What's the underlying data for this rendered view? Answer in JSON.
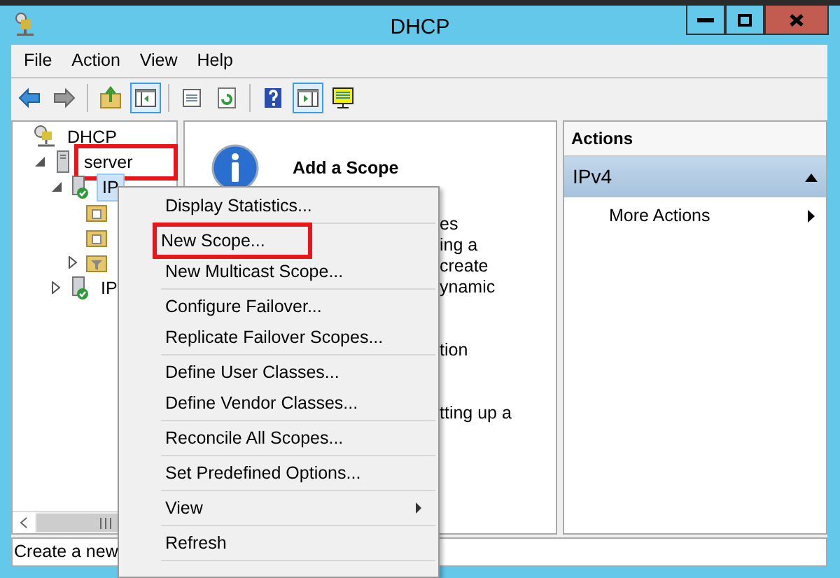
{
  "window": {
    "title": "DHCP"
  },
  "menu_bar": [
    "File",
    "Action",
    "View",
    "Help"
  ],
  "toolbar": [
    {
      "kind": "back",
      "pressed": false
    },
    {
      "kind": "forward",
      "pressed": false
    },
    {
      "kind": "sep"
    },
    {
      "kind": "up",
      "pressed": false
    },
    {
      "kind": "tree",
      "pressed": true
    },
    {
      "kind": "sep"
    },
    {
      "kind": "props",
      "pressed": false
    },
    {
      "kind": "refresh",
      "pressed": false
    },
    {
      "kind": "sep"
    },
    {
      "kind": "help",
      "pressed": false
    },
    {
      "kind": "pane",
      "pressed": true
    },
    {
      "kind": "monitor",
      "pressed": false
    }
  ],
  "tree": [
    {
      "label": "DHCP",
      "kind": "root",
      "children": [
        {
          "label": "server",
          "kind": "server",
          "expanded": true,
          "highlighted": true,
          "children": [
            {
              "label": "IP",
              "kind": "scope",
              "expanded": true,
              "selected": true,
              "children": [
                {
                  "kind": "folder"
                },
                {
                  "kind": "folder"
                },
                {
                  "kind": "filter",
                  "expanded": false
                }
              ]
            },
            {
              "label": "IP",
              "kind": "scope",
              "expanded": false,
              "selected": false
            }
          ]
        }
      ]
    }
  ],
  "center": {
    "title": "Add a Scope",
    "paragraphs": [
      [
        "es",
        "ing a",
        "create",
        "ynamic"
      ],
      [
        "tion"
      ],
      [
        "tting up a"
      ]
    ]
  },
  "actions": {
    "title": "Actions",
    "section": "IPv4",
    "section_expanded": true,
    "items": [
      {
        "label": "More Actions",
        "submenu": true
      }
    ]
  },
  "status_bar": "Create a new",
  "context_menu": [
    {
      "kind": "item",
      "label": "Display Statistics..."
    },
    {
      "kind": "separator"
    },
    {
      "kind": "item",
      "label": "New Scope...",
      "highlighted": true
    },
    {
      "kind": "item",
      "label": "New Multicast Scope..."
    },
    {
      "kind": "separator"
    },
    {
      "kind": "item",
      "label": "Configure Failover..."
    },
    {
      "kind": "item",
      "label": "Replicate Failover Scopes..."
    },
    {
      "kind": "separator"
    },
    {
      "kind": "item",
      "label": "Define User Classes..."
    },
    {
      "kind": "item",
      "label": "Define Vendor Classes..."
    },
    {
      "kind": "separator"
    },
    {
      "kind": "item",
      "label": "Reconcile All Scopes..."
    },
    {
      "kind": "separator"
    },
    {
      "kind": "item",
      "label": "Set Predefined Options..."
    },
    {
      "kind": "separator"
    },
    {
      "kind": "item",
      "label": "View",
      "submenu": true
    },
    {
      "kind": "separator"
    },
    {
      "kind": "item",
      "label": "Refresh"
    },
    {
      "kind": "separator"
    }
  ]
}
